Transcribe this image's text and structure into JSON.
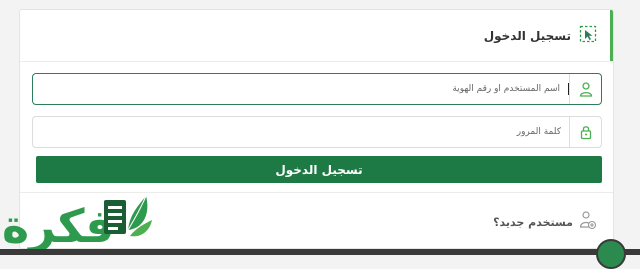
{
  "header": {
    "title": "تسجيل الدخول",
    "icon": "cursor-select-icon"
  },
  "form": {
    "username": {
      "placeholder": "اسم المستخدم أو رقم الهوية",
      "icon": "user-icon"
    },
    "password": {
      "placeholder": "كلمة المرور",
      "icon": "lock-icon"
    },
    "submit_label": "تسجيل الدخول"
  },
  "new_user": {
    "label": "مستخدم جديد؟",
    "icon": "add-user-icon"
  },
  "watermark": {
    "text": "فكرة",
    "icon": "book-leaf-icon"
  },
  "colors": {
    "accent": "#4caf50",
    "button": "#1e7a45",
    "logo": "#2e9a4d"
  }
}
